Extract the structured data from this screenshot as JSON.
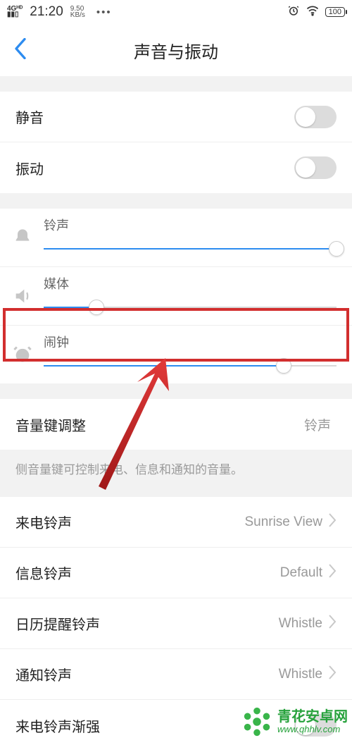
{
  "status_bar": {
    "network": "4Gᴴᴰ",
    "time": "21:20",
    "speed_top": "9.50",
    "speed_bot": "KB/s",
    "dots": "•••",
    "battery": "100"
  },
  "header": {
    "title": "声音与振动"
  },
  "toggles": {
    "mute_label": "静音",
    "vibrate_label": "振动"
  },
  "sliders": {
    "ringtone": {
      "label": "铃声",
      "value": 100
    },
    "media": {
      "label": "媒体",
      "value": 18
    },
    "alarm": {
      "label": "闹钟",
      "value": 82
    }
  },
  "volume_key": {
    "label": "音量键调整",
    "value": "铃声",
    "desc": "侧音量键可控制来电、信息和通知的音量。"
  },
  "ringtone_rows": {
    "incoming": {
      "label": "来电铃声",
      "value": "Sunrise View"
    },
    "message": {
      "label": "信息铃声",
      "value": "Default"
    },
    "calendar": {
      "label": "日历提醒铃声",
      "value": "Whistle"
    },
    "notify": {
      "label": "通知铃声",
      "value": "Whistle"
    },
    "ascending": {
      "label": "来电铃声渐强"
    }
  },
  "watermark": {
    "line1": "青花安卓网",
    "line2": "www.qhhlv.com"
  }
}
